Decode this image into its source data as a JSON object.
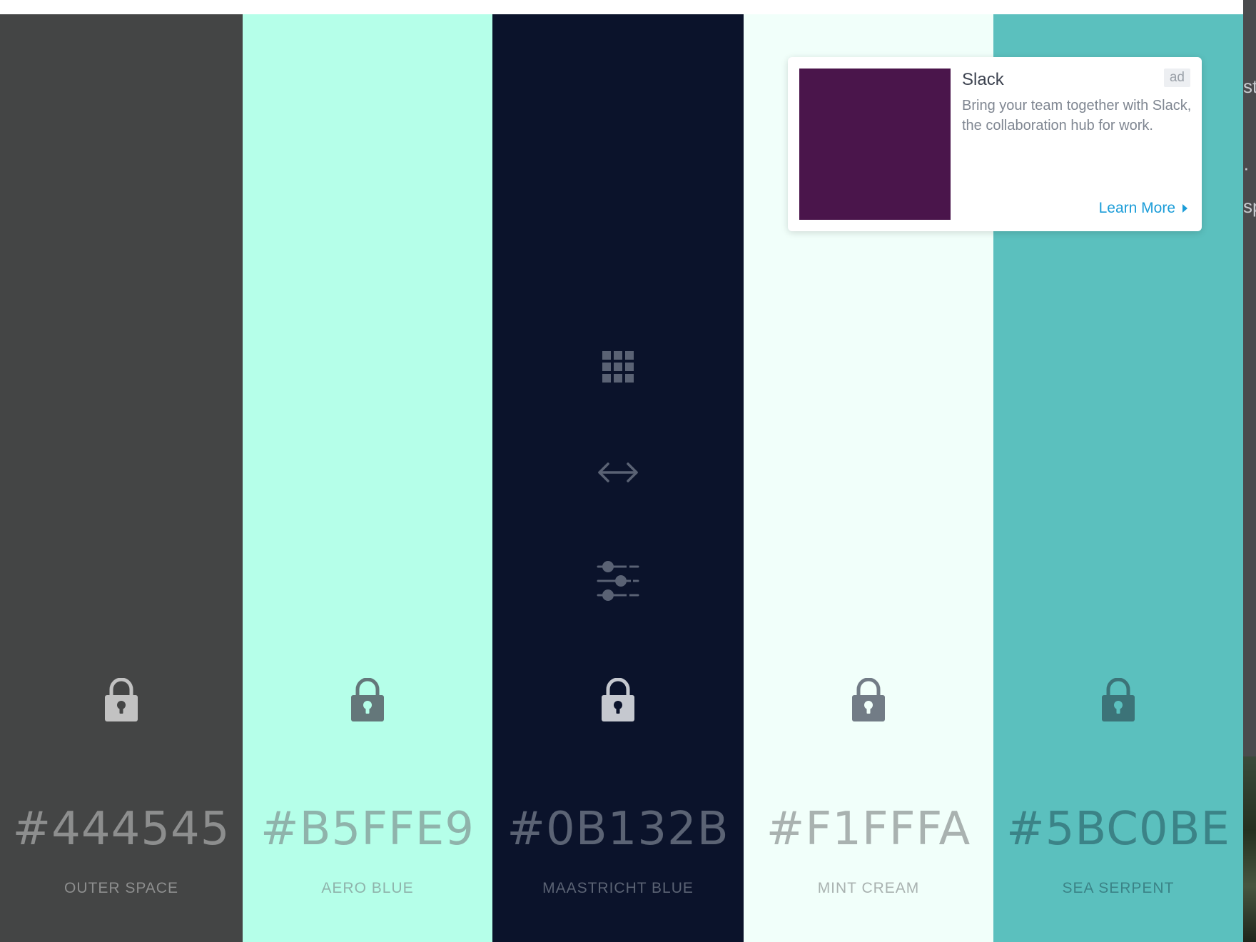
{
  "swatches": [
    {
      "hex": "#444545",
      "name": "OUTER SPACE",
      "bg": "#444545",
      "text_color": "#8d8e8e",
      "lock_color": "#c2c2c2",
      "keyhole_color": "#444545"
    },
    {
      "hex": "#B5FFE9",
      "name": "AERO BLUE",
      "bg": "#b5ffe9",
      "text_color": "#8fb3ab",
      "lock_color": "#64777a",
      "keyhole_color": "#b5ffe9"
    },
    {
      "hex": "#0B132B",
      "name": "MAASTRICHT BLUE",
      "bg": "#0b132b",
      "text_color": "#5b6374",
      "lock_color": "#c5c8cf",
      "keyhole_color": "#0b132b"
    },
    {
      "hex": "#F1FFFA",
      "name": "MINT CREAM",
      "bg": "#f1fffa",
      "text_color": "#a9b2b0",
      "lock_color": "#727c86",
      "keyhole_color": "#f1fffa"
    },
    {
      "hex": "#5BC0BE",
      "name": "SEA SERPENT",
      "bg": "#5bc0be",
      "text_color": "#3b8387",
      "lock_color": "#3c7378",
      "keyhole_color": "#5bc0be"
    }
  ],
  "tools": {
    "icons": [
      "grid-icon",
      "arrows-horizontal-icon",
      "sliders-icon"
    ],
    "color": "#5a6274"
  },
  "ad": {
    "title": "Slack",
    "description": "Bring your team together with Slack, the collaboration hub for work.",
    "tag": "ad",
    "cta": "Learn More",
    "image_color": "#4a154b",
    "cta_color": "#1a9cd8"
  },
  "right_edge_fragments": [
    "st",
    "·",
    "sp"
  ]
}
